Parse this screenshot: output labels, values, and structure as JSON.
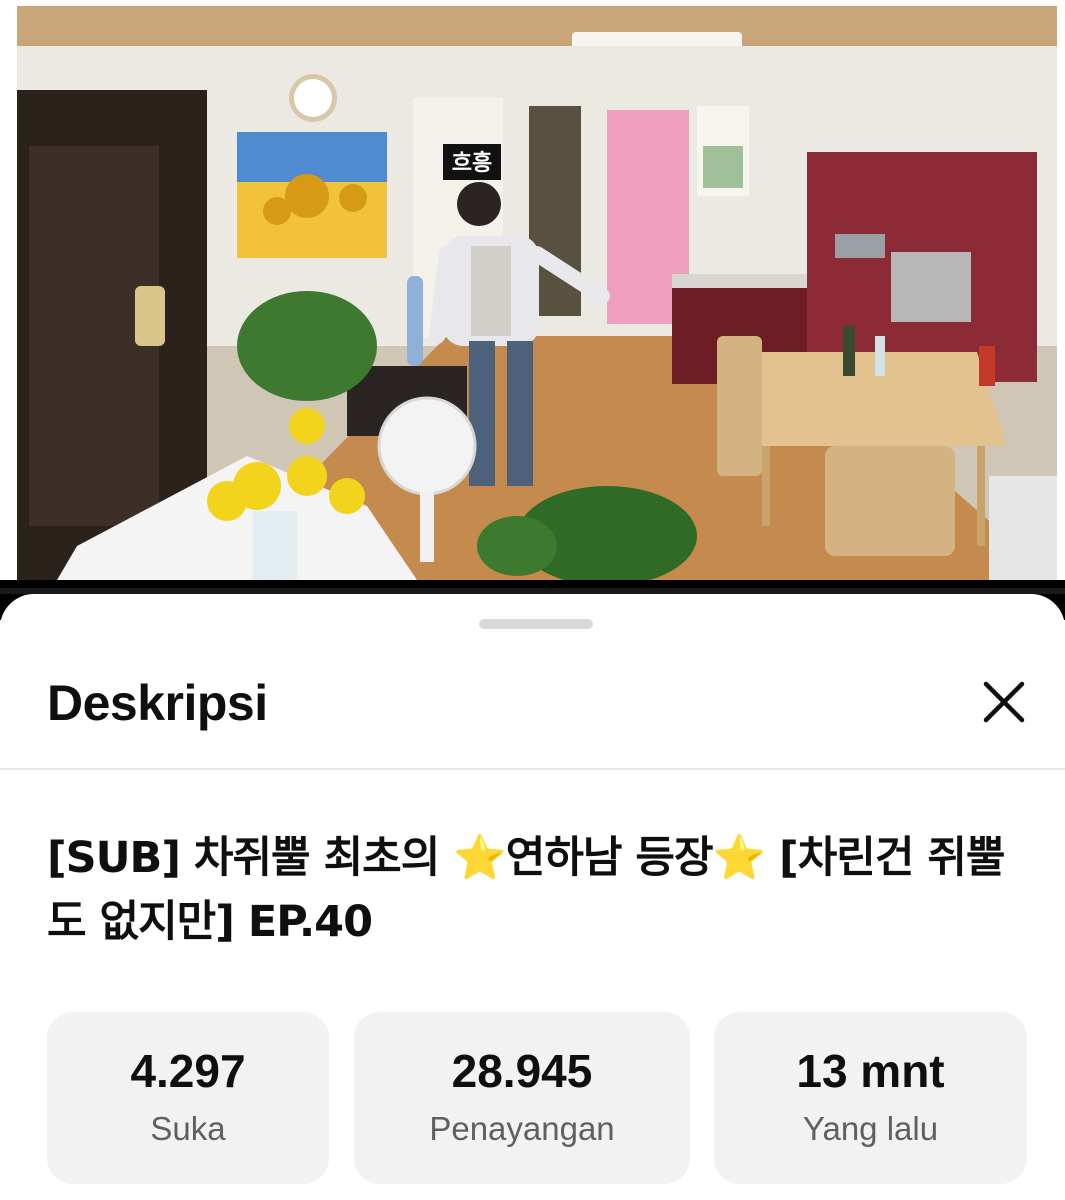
{
  "video": {
    "overlay_caption": "흐흥",
    "progress_fraction": 0.0
  },
  "sheet": {
    "title": "Deskripsi",
    "close_icon": "close-icon"
  },
  "video_title": "[SUB] 차쥐뿔 최초의 ⭐연하남 등장⭐  [차린건 쥐뿔도 없지만] EP.40",
  "stats": [
    {
      "value": "4.297",
      "label": "Suka"
    },
    {
      "value": "28.945",
      "label": "Penayangan"
    },
    {
      "value": "13 mnt",
      "label": "Yang lalu"
    }
  ],
  "colors": {
    "progress": "#ff0000",
    "stat_background": "#f2f2f2",
    "secondary_text": "#606060"
  }
}
